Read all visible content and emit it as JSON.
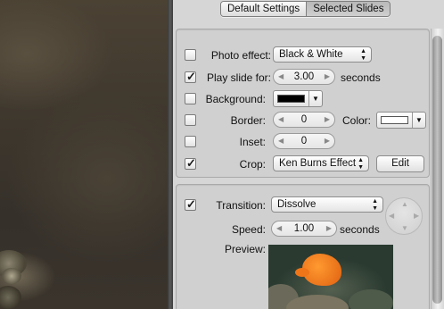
{
  "tabs": [
    {
      "label": "Default Settings",
      "active": false
    },
    {
      "label": "Selected Slides",
      "active": true
    }
  ],
  "rows": {
    "photo_effect": {
      "label": "Photo effect:",
      "checked": false,
      "value": "Black & White"
    },
    "play_slide": {
      "label": "Play slide for:",
      "checked": true,
      "value": "3.00",
      "unit": "seconds"
    },
    "background": {
      "label": "Background:",
      "checked": false,
      "swatch_color": "#000000"
    },
    "border": {
      "label": "Border:",
      "checked": false,
      "value": "0",
      "color_label": "Color:",
      "swatch_color": "#ffffff"
    },
    "inset": {
      "label": "Inset:",
      "checked": false,
      "value": "0"
    },
    "crop": {
      "label": "Crop:",
      "checked": true,
      "value": "Ken Burns Effect",
      "edit_label": "Edit"
    }
  },
  "transition": {
    "label": "Transition:",
    "checked": true,
    "value": "Dissolve",
    "speed_label": "Speed:",
    "speed_value": "1.00",
    "speed_unit": "seconds",
    "preview_label": "Preview:"
  },
  "icons": {
    "checkmark": "✓",
    "left_arrow": "◀",
    "right_arrow": "▶",
    "up_arrow": "▲",
    "down_arrow": "▼"
  }
}
